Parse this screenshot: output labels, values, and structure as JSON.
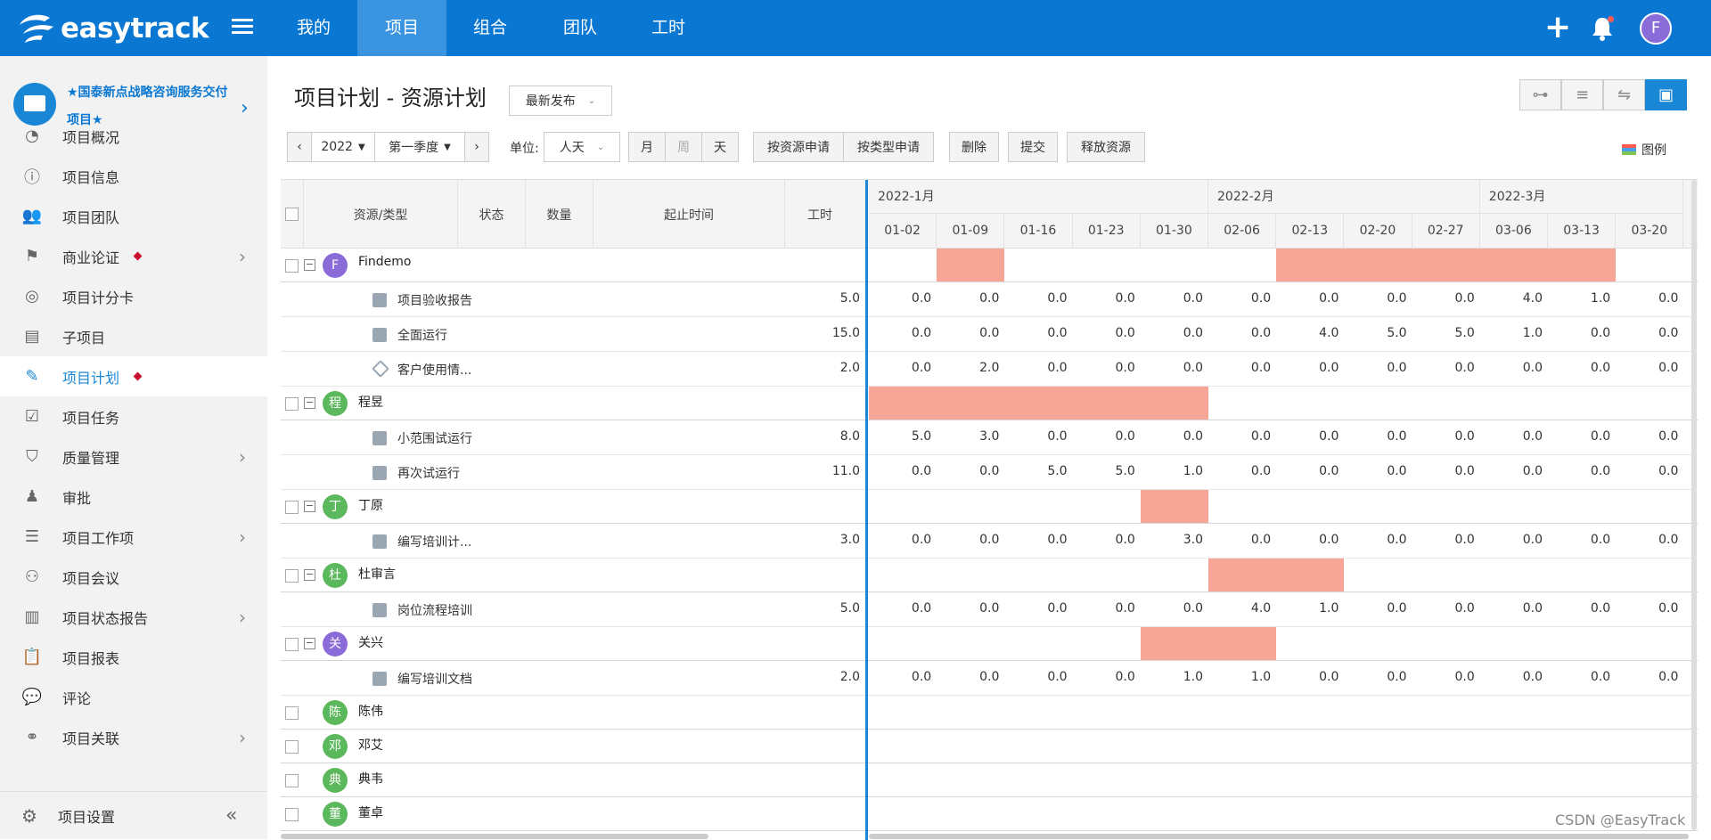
{
  "brand": {
    "name": "easytrack"
  },
  "topnav": {
    "tabs": [
      {
        "label": "我的",
        "active": false
      },
      {
        "label": "项目",
        "active": true
      },
      {
        "label": "组合",
        "active": false
      },
      {
        "label": "团队",
        "active": false
      },
      {
        "label": "工时",
        "active": false
      }
    ],
    "user_initial": "F"
  },
  "sidebar": {
    "project_title": "★国泰新点战略咨询服务交付项目★",
    "items": [
      {
        "label": "项目概况",
        "icon": "pie-chart-icon",
        "active": false,
        "marked": false,
        "arrow": false
      },
      {
        "label": "项目信息",
        "icon": "info-icon",
        "active": false,
        "marked": false,
        "arrow": false
      },
      {
        "label": "项目团队",
        "icon": "team-icon",
        "active": false,
        "marked": false,
        "arrow": false
      },
      {
        "label": "商业论证",
        "icon": "flag-icon",
        "active": false,
        "marked": true,
        "arrow": true
      },
      {
        "label": "项目计分卡",
        "icon": "target-icon",
        "active": false,
        "marked": false,
        "arrow": false
      },
      {
        "label": "子项目",
        "icon": "document-icon",
        "active": false,
        "marked": false,
        "arrow": false
      },
      {
        "label": "项目计划",
        "icon": "plan-edit-icon",
        "active": true,
        "marked": true,
        "arrow": false
      },
      {
        "label": "项目任务",
        "icon": "task-check-icon",
        "active": false,
        "marked": false,
        "arrow": false
      },
      {
        "label": "质量管理",
        "icon": "shield-icon",
        "active": false,
        "marked": false,
        "arrow": true
      },
      {
        "label": "审批",
        "icon": "stamp-icon",
        "active": false,
        "marked": false,
        "arrow": false
      },
      {
        "label": "项目工作项",
        "icon": "list-stack-icon",
        "active": false,
        "marked": false,
        "arrow": true
      },
      {
        "label": "项目会议",
        "icon": "meeting-icon",
        "active": false,
        "marked": false,
        "arrow": false
      },
      {
        "label": "项目状态报告",
        "icon": "bar-report-icon",
        "active": false,
        "marked": false,
        "arrow": true
      },
      {
        "label": "项目报表",
        "icon": "clipboard-chart-icon",
        "active": false,
        "marked": false,
        "arrow": false
      },
      {
        "label": "评论",
        "icon": "comment-icon",
        "active": false,
        "marked": false,
        "arrow": false
      },
      {
        "label": "项目关联",
        "icon": "link-icon",
        "active": false,
        "marked": false,
        "arrow": true
      }
    ],
    "footer_label": "项目设置"
  },
  "page": {
    "title": "项目计划 - 资源计划",
    "publish_select": "最新发布",
    "year": "2022",
    "quarter": "第一季度",
    "unit_label": "单位:",
    "unit_value": "人天",
    "period_buttons": [
      "月",
      "周",
      "天"
    ],
    "action_buttons": [
      "按资源申请",
      "按类型申请",
      "删除",
      "提交",
      "释放资源"
    ],
    "legend_label": "图例"
  },
  "table": {
    "columns": [
      "资源/类型",
      "状态",
      "数量",
      "起止时间",
      "工时"
    ],
    "months": [
      "2022-1月",
      "2022-2月",
      "2022-3月"
    ],
    "weeks": [
      "01-02",
      "01-09",
      "01-16",
      "01-23",
      "01-30",
      "02-06",
      "02-13",
      "02-20",
      "02-27",
      "03-06",
      "03-13",
      "03-20"
    ],
    "rows": [
      {
        "type": "resource",
        "name": "Findemo",
        "initial": "F",
        "color": "#8a6bd8",
        "bars": [
          [
            1,
            1
          ],
          [
            6,
            10
          ]
        ]
      },
      {
        "type": "task",
        "name": "项目验收报告",
        "hours": "5.0",
        "values": [
          "0.0",
          "0.0",
          "0.0",
          "0.0",
          "0.0",
          "0.0",
          "0.0",
          "0.0",
          "0.0",
          "4.0",
          "1.0",
          "0.0"
        ]
      },
      {
        "type": "task",
        "name": "全面运行",
        "hours": "15.0",
        "values": [
          "0.0",
          "0.0",
          "0.0",
          "0.0",
          "0.0",
          "0.0",
          "4.0",
          "5.0",
          "5.0",
          "1.0",
          "0.0",
          "0.0"
        ]
      },
      {
        "type": "milestone",
        "name": "客户使用情...",
        "hours": "2.0",
        "values": [
          "0.0",
          "2.0",
          "0.0",
          "0.0",
          "0.0",
          "0.0",
          "0.0",
          "0.0",
          "0.0",
          "0.0",
          "0.0",
          "0.0"
        ]
      },
      {
        "type": "resource",
        "name": "程昱",
        "initial": "程",
        "color": "#5cb85c",
        "bars": [
          [
            0,
            4
          ]
        ]
      },
      {
        "type": "task",
        "name": "小范围试运行",
        "hours": "8.0",
        "values": [
          "5.0",
          "3.0",
          "0.0",
          "0.0",
          "0.0",
          "0.0",
          "0.0",
          "0.0",
          "0.0",
          "0.0",
          "0.0",
          "0.0"
        ]
      },
      {
        "type": "task",
        "name": "再次试运行",
        "hours": "11.0",
        "values": [
          "0.0",
          "0.0",
          "5.0",
          "5.0",
          "1.0",
          "0.0",
          "0.0",
          "0.0",
          "0.0",
          "0.0",
          "0.0",
          "0.0"
        ]
      },
      {
        "type": "resource",
        "name": "丁原",
        "initial": "丁",
        "color": "#5cb85c",
        "bars": [
          [
            4,
            4
          ]
        ]
      },
      {
        "type": "task",
        "name": "编写培训计...",
        "hours": "3.0",
        "values": [
          "0.0",
          "0.0",
          "0.0",
          "0.0",
          "3.0",
          "0.0",
          "0.0",
          "0.0",
          "0.0",
          "0.0",
          "0.0",
          "0.0"
        ]
      },
      {
        "type": "resource",
        "name": "杜审言",
        "initial": "杜",
        "color": "#5cb85c",
        "bars": [
          [
            5,
            6
          ]
        ]
      },
      {
        "type": "task",
        "name": "岗位流程培训",
        "hours": "5.0",
        "values": [
          "0.0",
          "0.0",
          "0.0",
          "0.0",
          "0.0",
          "4.0",
          "1.0",
          "0.0",
          "0.0",
          "0.0",
          "0.0",
          "0.0"
        ]
      },
      {
        "type": "resource",
        "name": "关兴",
        "initial": "关",
        "color": "#8a6bd8",
        "bars": [
          [
            4,
            5
          ]
        ]
      },
      {
        "type": "task",
        "name": "编写培训文档",
        "hours": "2.0",
        "values": [
          "0.0",
          "0.0",
          "0.0",
          "0.0",
          "1.0",
          "1.0",
          "0.0",
          "0.0",
          "0.0",
          "0.0",
          "0.0",
          "0.0"
        ]
      },
      {
        "type": "resource-plain",
        "name": "陈伟",
        "initial": "陈",
        "color": "#5cb85c",
        "bars": []
      },
      {
        "type": "resource-plain",
        "name": "邓艾",
        "initial": "邓",
        "color": "#5cb85c",
        "bars": []
      },
      {
        "type": "resource-plain",
        "name": "典韦",
        "initial": "典",
        "color": "#5cb85c",
        "bars": []
      },
      {
        "type": "resource-plain",
        "name": "董卓",
        "initial": "董",
        "color": "#5cb85c",
        "bars": []
      }
    ]
  },
  "watermark": "CSDN @EasyTrack"
}
